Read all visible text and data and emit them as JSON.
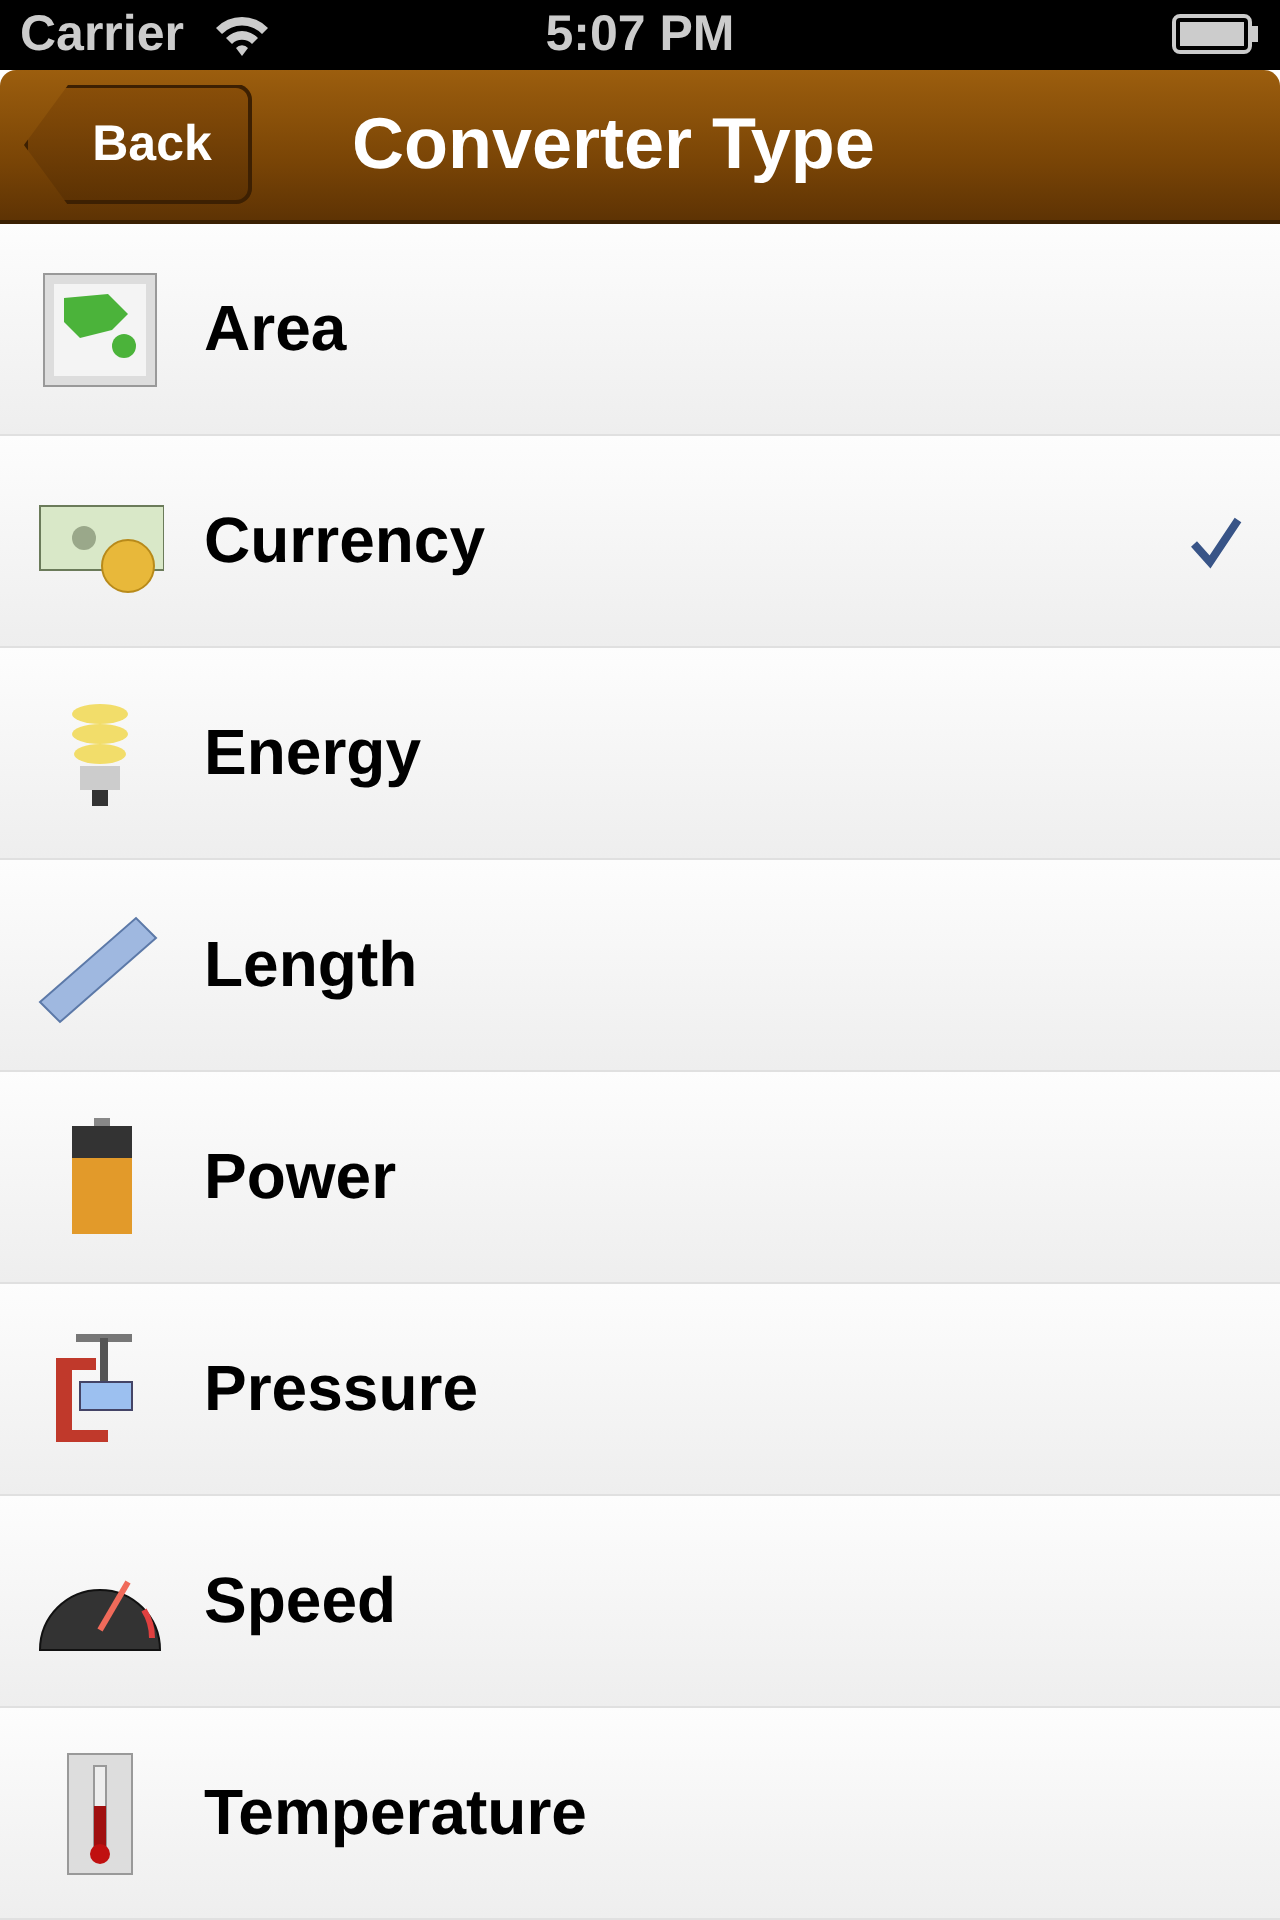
{
  "status_bar": {
    "carrier": "Carrier",
    "time": "5:07 PM"
  },
  "nav_bar": {
    "back": "Back",
    "title": "Converter Type"
  },
  "items": [
    {
      "kind": "area",
      "label": "Area",
      "selected": false
    },
    {
      "kind": "currency",
      "label": "Currency",
      "selected": true
    },
    {
      "kind": "energy",
      "label": "Energy",
      "selected": false
    },
    {
      "kind": "length",
      "label": "Length",
      "selected": false
    },
    {
      "kind": "power",
      "label": "Power",
      "selected": false
    },
    {
      "kind": "pressure",
      "label": "Pressure",
      "selected": false
    },
    {
      "kind": "speed",
      "label": "Speed",
      "selected": false
    },
    {
      "kind": "temperature",
      "label": "Temperature",
      "selected": false
    }
  ]
}
